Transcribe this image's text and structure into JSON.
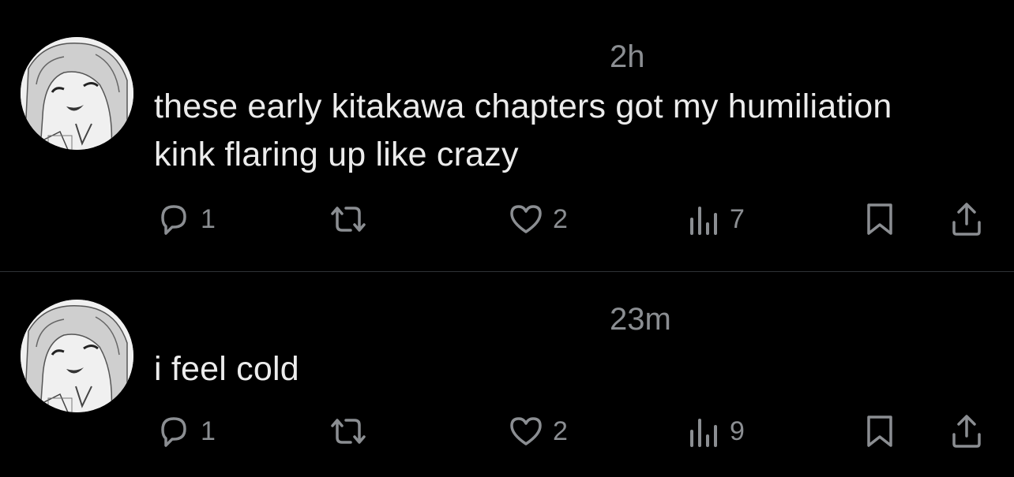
{
  "posts": [
    {
      "timestamp": "2h",
      "text_lines": [
        "these early kitakawa chapters got my humiliation",
        "kink flaring up like crazy"
      ],
      "stats": {
        "replies": "1",
        "likes": "2",
        "views": "7"
      }
    },
    {
      "timestamp": "23m",
      "text_lines": [
        "i feel cold"
      ],
      "stats": {
        "replies": "1",
        "likes": "2",
        "views": "9"
      }
    }
  ],
  "icons": {
    "reply": "reply-icon",
    "repost": "repost-icon",
    "like": "heart-icon",
    "views": "views-icon",
    "bookmark": "bookmark-icon",
    "share": "share-icon"
  },
  "colors": {
    "background": "#000000",
    "text": "#ececec",
    "muted": "#8b8e92",
    "divider": "#2f3336"
  }
}
